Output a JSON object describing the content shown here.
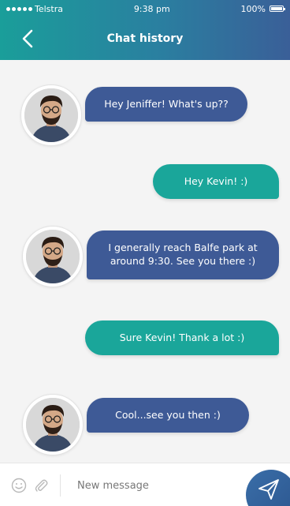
{
  "status": {
    "carrier": "Telstra",
    "time": "9:38 pm",
    "battery": "100%"
  },
  "header": {
    "title": "Chat history"
  },
  "messages": [
    {
      "from": "them",
      "text": "Hey Jeniffer! What's up??"
    },
    {
      "from": "me",
      "text": "Hey Kevin! :)"
    },
    {
      "from": "them",
      "text": "I generally reach Balfe park at around 9:30. See you there :)"
    },
    {
      "from": "me",
      "text": "Sure Kevin! Thank a lot :)"
    },
    {
      "from": "them",
      "text": "Cool...see you then :)"
    }
  ],
  "composer": {
    "placeholder": "New message"
  },
  "colors": {
    "incoming": "#3e5a96",
    "outgoing": "#1aa69a",
    "header_start": "#1a9e9a",
    "header_end": "#3a5f98"
  }
}
